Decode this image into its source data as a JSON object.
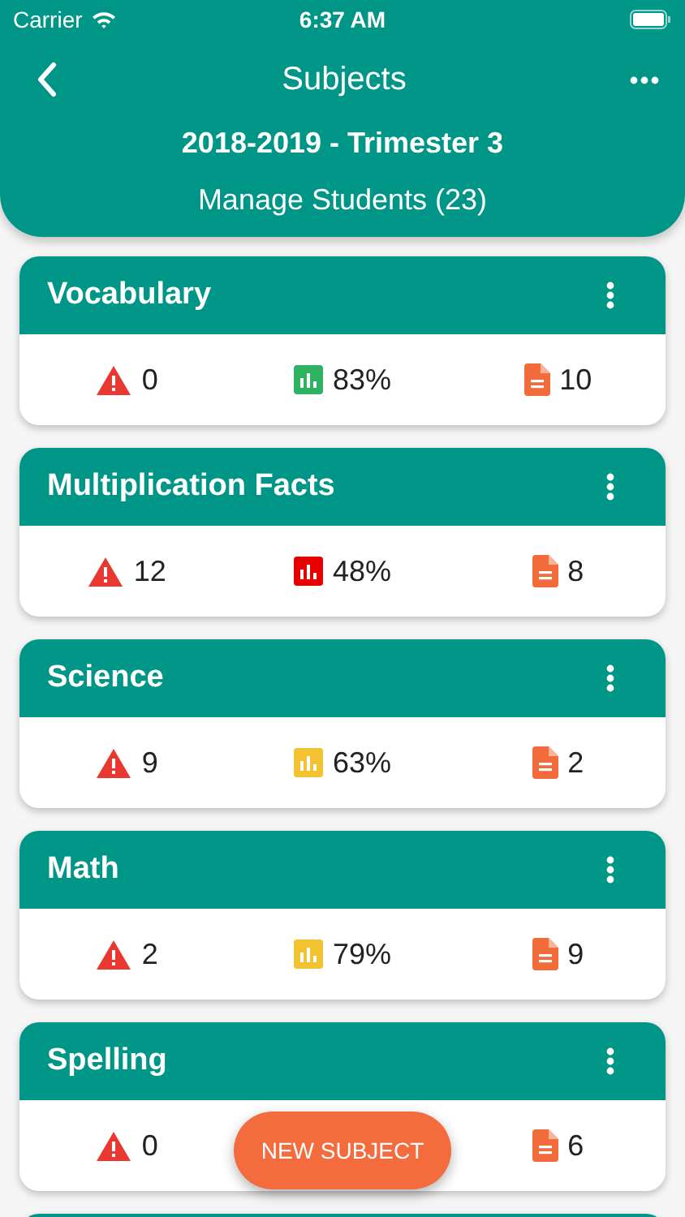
{
  "status_bar": {
    "carrier": "Carrier",
    "time": "6:37 AM"
  },
  "nav": {
    "title": "Subjects",
    "term": "2018-2019 - Trimester 3",
    "manage": "Manage Students (23)"
  },
  "subjects": [
    {
      "name": "Vocabulary",
      "alerts": "0",
      "grade": {
        "value": "83%",
        "color": "#2eb363"
      },
      "documents": "10"
    },
    {
      "name": "Multiplication Facts",
      "alerts": "12",
      "grade": {
        "value": "48%",
        "color": "#e60000"
      },
      "documents": "8"
    },
    {
      "name": "Science",
      "alerts": "9",
      "grade": {
        "value": "63%",
        "color": "#f2c230"
      },
      "documents": "2"
    },
    {
      "name": "Math",
      "alerts": "2",
      "grade": {
        "value": "79%",
        "color": "#f2c230"
      },
      "documents": "9"
    },
    {
      "name": "Spelling",
      "alerts": "0",
      "documents": "6"
    }
  ],
  "fab": "NEW SUBJECT"
}
